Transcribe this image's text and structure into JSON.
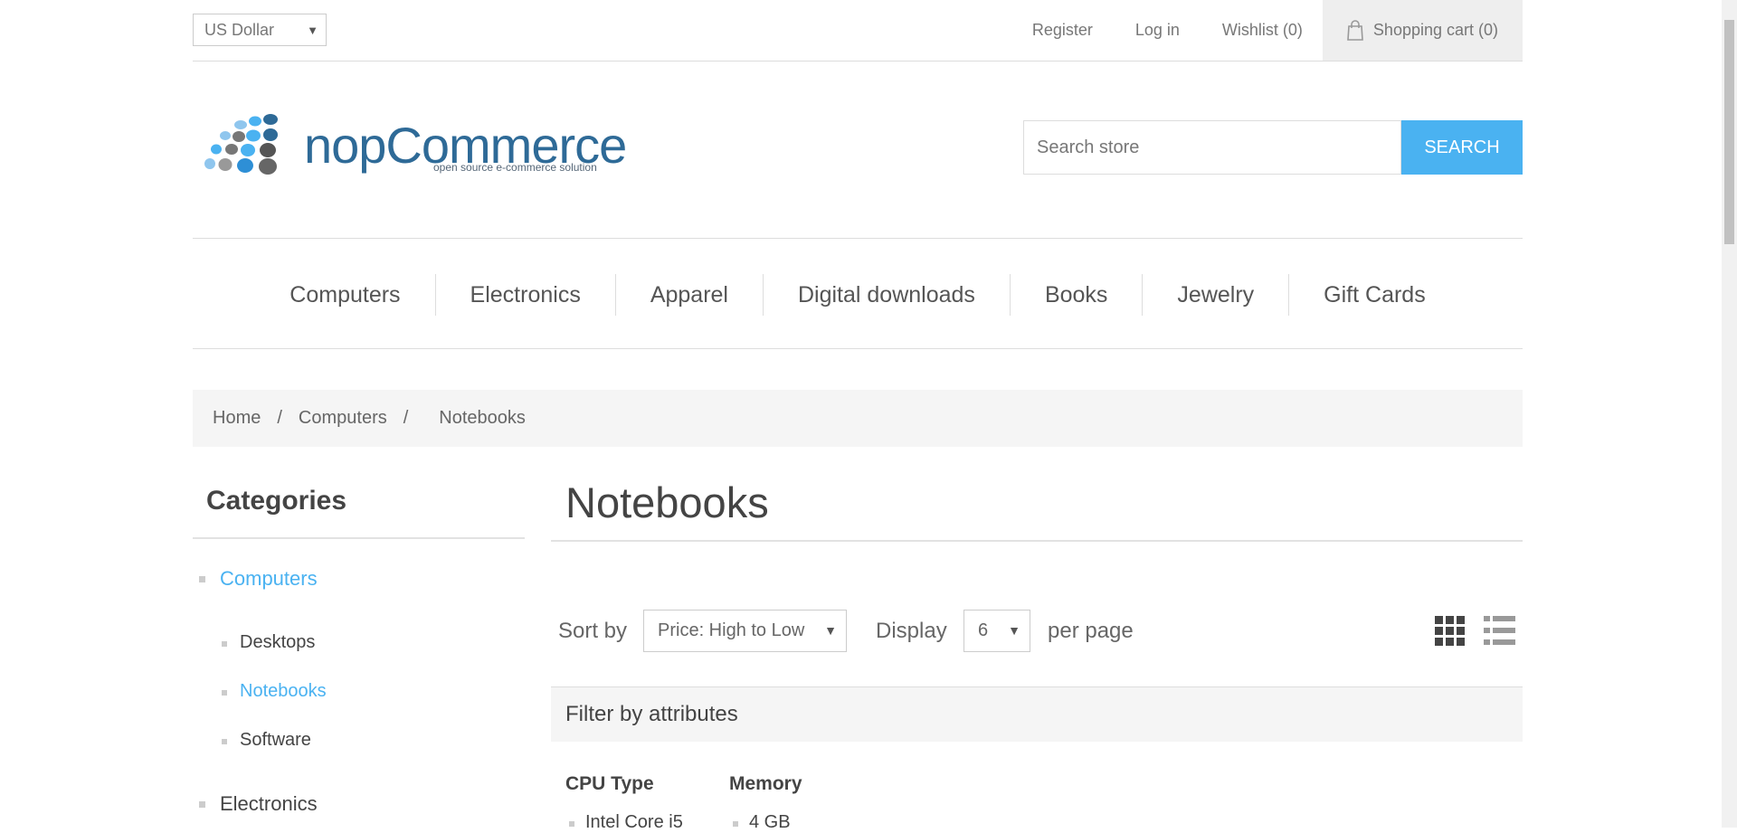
{
  "header": {
    "currency": "US Dollar",
    "links": {
      "register": "Register",
      "login": "Log in",
      "wishlist": "Wishlist (0)",
      "cart": "Shopping cart (0)"
    },
    "logo": {
      "name": "nopCommerce",
      "tagline": "open source e-commerce solution"
    },
    "search": {
      "placeholder": "Search store",
      "button": "SEARCH"
    }
  },
  "nav": {
    "items": [
      "Computers",
      "Electronics",
      "Apparel",
      "Digital downloads",
      "Books",
      "Jewelry",
      "Gift Cards"
    ]
  },
  "breadcrumb": {
    "home": "Home",
    "sep": "/",
    "parent": "Computers",
    "current": "Notebooks"
  },
  "sidebar": {
    "title": "Categories",
    "categories": [
      {
        "label": "Computers",
        "active": true
      },
      {
        "label": "Electronics",
        "active": false
      }
    ],
    "subcategories": [
      "Desktops",
      "Notebooks",
      "Software"
    ]
  },
  "main": {
    "title": "Notebooks",
    "sort_label": "Sort by",
    "sort_value": "Price: High to Low",
    "display_label": "Display",
    "display_value": "6",
    "per_page_label": "per page",
    "filter_title": "Filter by attributes",
    "attributes": [
      {
        "name": "CPU Type",
        "first_value": "Intel Core i5"
      },
      {
        "name": "Memory",
        "first_value": "4 GB"
      }
    ]
  },
  "colors": {
    "accent": "#4ab2f1",
    "text": "#444444",
    "muted": "#777777"
  }
}
